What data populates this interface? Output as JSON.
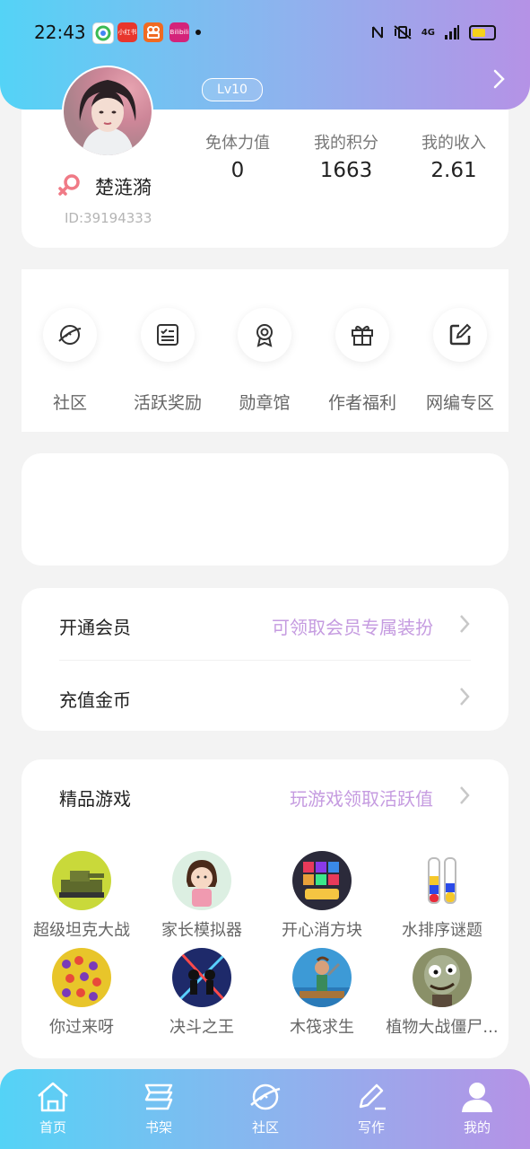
{
  "status_bar": {
    "time": "22:43",
    "notif_apps": [
      {
        "name": "app-notification-1",
        "color": "#ffffff",
        "text": ""
      },
      {
        "name": "app-notification-2",
        "color": "#e8362c",
        "text": "小红书"
      },
      {
        "name": "app-notification-3",
        "color": "#f06a22",
        "text": ""
      },
      {
        "name": "app-notification-4",
        "color": "#d4237a",
        "text": "Bilibili"
      }
    ],
    "network_label": "4G",
    "battery_level": 0.55
  },
  "header": {
    "level": "Lv10",
    "gradient_start": "#54d3f6",
    "gradient_end": "#b592e6"
  },
  "profile": {
    "username": "楚涟漪",
    "user_id": "ID:39194333",
    "gender": "female",
    "stats": [
      {
        "label": "免体力值",
        "value": "0"
      },
      {
        "label": "我的积分",
        "value": "1663"
      },
      {
        "label": "我的收入",
        "value": "2.61"
      }
    ]
  },
  "shortcuts": [
    {
      "label": "社区",
      "icon": "planet-icon"
    },
    {
      "label": "活跃奖励",
      "icon": "checklist-icon"
    },
    {
      "label": "勋章馆",
      "icon": "medal-icon"
    },
    {
      "label": "作者福利",
      "icon": "gift-icon"
    },
    {
      "label": "网编专区",
      "icon": "edit-icon"
    }
  ],
  "menu": {
    "vip": {
      "title": "开通会员",
      "hint": "可领取会员专属装扮"
    },
    "recharge": {
      "title": "充值金币",
      "hint": ""
    }
  },
  "games": {
    "title": "精品游戏",
    "hint": "玩游戏领取活跃值",
    "items": [
      {
        "name": "超级坦克大战",
        "icon": "tank-game-icon",
        "color": "#c9d93a"
      },
      {
        "name": "家长模拟器",
        "icon": "parent-simulator-icon",
        "color": "#dcefe2"
      },
      {
        "name": "开心消方块",
        "icon": "block-puzzle-icon",
        "color": "#2b2a3a"
      },
      {
        "name": "水排序谜题",
        "icon": "water-sort-icon",
        "color": "#ffffff"
      },
      {
        "name": "你过来呀",
        "icon": "crowd-battle-icon",
        "color": "#e8c52a"
      },
      {
        "name": "决斗之王",
        "icon": "duel-king-icon",
        "color": "#1e2a6a"
      },
      {
        "name": "木筏求生",
        "icon": "raft-survival-icon",
        "color": "#3d9ad6"
      },
      {
        "name": "植物大战僵尸...",
        "icon": "zombie-game-icon",
        "color": "#8a9068"
      }
    ]
  },
  "tabs": [
    {
      "label": "首页",
      "icon": "home-icon"
    },
    {
      "label": "书架",
      "icon": "bookshelf-icon"
    },
    {
      "label": "社区",
      "icon": "planet-icon"
    },
    {
      "label": "写作",
      "icon": "pen-icon"
    },
    {
      "label": "我的",
      "icon": "person-icon"
    }
  ]
}
